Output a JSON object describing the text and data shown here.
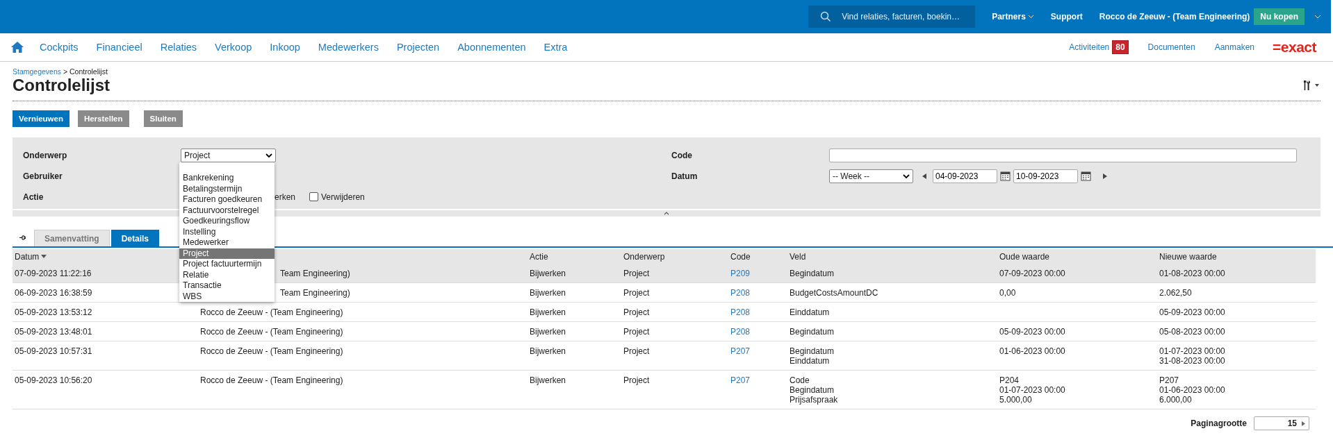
{
  "top_bar": {
    "search": {
      "placeholder": "Vind relaties, facturen, boekin…"
    },
    "links": [
      {
        "label": "Partners",
        "has_menu": true
      },
      {
        "label": "Support",
        "has_menu": false
      },
      {
        "label": "Rocco de Zeeuw - (Team Engineering)",
        "has_menu": false
      }
    ],
    "buy_button": "Nu kopen"
  },
  "nav": {
    "items": [
      "Cockpits",
      "Financieel",
      "Relaties",
      "Verkoop",
      "Inkoop",
      "Medewerkers",
      "Projecten",
      "Abonnementen",
      "Extra"
    ],
    "activities": {
      "label": "Activiteiten",
      "badge": "80"
    },
    "links": [
      "Documenten",
      "Aanmaken"
    ],
    "logo": "=exact"
  },
  "breadcrumb": {
    "parent": "Stamgegevens",
    "current": "> Controlelijst"
  },
  "title": "Controlelijst",
  "buttons": [
    {
      "label": "Vernieuwen",
      "primary": true
    },
    {
      "label": "Herstellen",
      "primary": false
    },
    {
      "label": "Sluiten",
      "primary": false
    }
  ],
  "filters": {
    "onderwerp": {
      "label": "Onderwerp",
      "value": "Project"
    },
    "gebruiker": {
      "label": "Gebruiker"
    },
    "actie": {
      "label": "Actie",
      "options": [
        {
          "kind": "cut",
          "label": "erken"
        },
        {
          "kind": "checkbox",
          "label": "Verwijderen",
          "checked": false
        }
      ]
    },
    "code": {
      "label": "Code"
    },
    "datum": {
      "label": "Datum",
      "period": "-- Week --",
      "from": "04-09-2023",
      "to": "10-09-2023"
    }
  },
  "dropdown": {
    "options": [
      {
        "label": "Bankrekening",
        "selected": false
      },
      {
        "label": "Betalingstermijn",
        "selected": false
      },
      {
        "label": "Facturen goedkeuren",
        "selected": false
      },
      {
        "label": "Factuurvoorstelregel",
        "selected": false
      },
      {
        "label": "Goedkeuringsflow",
        "selected": false
      },
      {
        "label": "Instelling",
        "selected": false
      },
      {
        "label": "Medewerker",
        "selected": false
      },
      {
        "label": "Project",
        "selected": true
      },
      {
        "label": "Project factuurtermijn",
        "selected": false
      },
      {
        "label": "Relatie",
        "selected": false
      },
      {
        "label": "Transactie",
        "selected": false
      },
      {
        "label": "WBS",
        "selected": false
      }
    ]
  },
  "tabs": [
    {
      "label": "Samenvatting",
      "selected": false
    },
    {
      "label": "Details",
      "selected": true
    }
  ],
  "table": {
    "columns": [
      "Datum",
      "",
      "Actie",
      "Onderwerp",
      "Code",
      "Veld",
      "Oude waarde",
      "Nieuwe waarde"
    ],
    "rows": [
      {
        "datum": "07-09-2023 11:22:16",
        "gebruiker": "Team Engineering)",
        "actie": "Bijwerken",
        "onderwerp": "Project",
        "code": "P209",
        "selected": true,
        "changes": [
          {
            "veld": "Begindatum",
            "oude": "07-09-2023 00:00",
            "nieuwe": "01-08-2023 00:00"
          }
        ]
      },
      {
        "datum": "06-09-2023 16:38:59",
        "gebruiker": "Team Engineering)",
        "actie": "Bijwerken",
        "onderwerp": "Project",
        "code": "P208",
        "selected": false,
        "changes": [
          {
            "veld": "BudgetCostsAmountDC",
            "oude": "0,00",
            "nieuwe": "2.062,50"
          }
        ]
      },
      {
        "datum": "05-09-2023 13:53:12",
        "gebruiker": "Rocco de Zeeuw - (Team Engineering)",
        "actie": "Bijwerken",
        "onderwerp": "Project",
        "code": "P208",
        "selected": false,
        "changes": [
          {
            "veld": "Einddatum",
            "nieuwe": "05-09-2023 00:00"
          }
        ]
      },
      {
        "datum": "05-09-2023 13:48:01",
        "gebruiker": "Rocco de Zeeuw - (Team Engineering)",
        "actie": "Bijwerken",
        "onderwerp": "Project",
        "code": "P208",
        "selected": false,
        "changes": [
          {
            "veld": "Begindatum",
            "oude": "05-09-2023 00:00",
            "nieuwe": "05-08-2023 00:00"
          }
        ]
      },
      {
        "datum": "05-09-2023 10:57:31",
        "gebruiker": "Rocco de Zeeuw - (Team Engineering)",
        "actie": "Bijwerken",
        "onderwerp": "Project",
        "code": "P207",
        "selected": false,
        "changes": [
          {
            "veld": "Begindatum",
            "oude": "01-06-2023 00:00",
            "nieuwe": "01-07-2023 00:00"
          },
          {
            "veld": "Einddatum",
            "nieuwe": "31-08-2023 00:00"
          }
        ]
      },
      {
        "datum": "05-09-2023 10:56:20",
        "gebruiker": "Rocco de Zeeuw - (Team Engineering)",
        "actie": "Bijwerken",
        "onderwerp": "Project",
        "code": "P207",
        "selected": false,
        "changes": [
          {
            "veld": "Code",
            "oude": "P204",
            "nieuwe": "P207"
          },
          {
            "veld": "Begindatum",
            "oude": "01-07-2023 00:00",
            "nieuwe": "01-06-2023 00:00"
          },
          {
            "veld": "Prijsafspraak",
            "oude": "5.000,00",
            "nieuwe": "6.000,00"
          }
        ]
      }
    ]
  },
  "pagination": {
    "label": "Paginagrootte",
    "value": "15"
  }
}
